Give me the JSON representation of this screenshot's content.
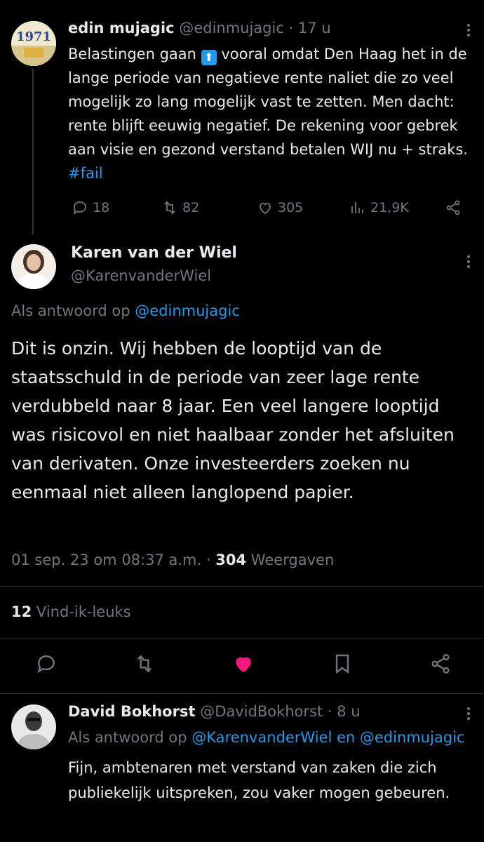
{
  "tweet1": {
    "display_name": "edin mujagic",
    "handle": "@edinmujagic",
    "time": "· 17 u",
    "avatar_text": "1971",
    "text_before": "Belastingen gaan ",
    "text_after": " vooral omdat Den Haag het in de lange periode van negatieve rente naliet die zo veel mogelijk zo lang mogelijk vast te zetten. Men dacht: rente blijft eeuwig negatief. De rekening voor  gebrek aan visie en gezond verstand betalen WIJ nu + straks. ",
    "hashtag": "#fail",
    "emoji": "⬆",
    "replies": "18",
    "retweets": "82",
    "likes": "305",
    "views": "21,9K"
  },
  "main_tweet": {
    "display_name": "Karen van der Wiel",
    "handle": "@KarenvanderWiel",
    "reply_prefix": "Als antwoord op",
    "reply_to": "@edinmujagic",
    "text": "Dit is onzin. Wij hebben de looptijd van de staatsschuld in de periode van zeer lage rente verdubbeld naar 8 jaar. Een veel langere looptijd was risicovol en niet haalbaar zonder het afsluiten van derivaten. Onze investeerders zoeken nu eenmaal niet alleen langlopend papier.",
    "timestamp": "01 sep. 23 om 08:37 a.m.",
    "dot": "·",
    "views_count": "304",
    "views_label": "Weergaven",
    "likes_count": "12",
    "likes_label": "Vind-ik-leuks"
  },
  "tweet3": {
    "display_name": "David Bokhorst",
    "handle": "@DavidBokhorst",
    "time": "· 8 u",
    "reply_prefix": "Als antwoord op",
    "reply_to": "@KarenvanderWiel en @edinmujagic",
    "text": "Fijn, ambtenaren met verstand van zaken die zich publiekelijk uitspreken, zou vaker mogen gebeuren."
  },
  "colors": {
    "background": "#000000",
    "text": "#e7e9ea",
    "muted": "#71767b",
    "link": "#1d9bf0",
    "like": "#f91880"
  },
  "icons": [
    "reply-icon",
    "retweet-icon",
    "like-icon",
    "views-icon",
    "share-icon",
    "bookmark-icon",
    "more-icon"
  ]
}
